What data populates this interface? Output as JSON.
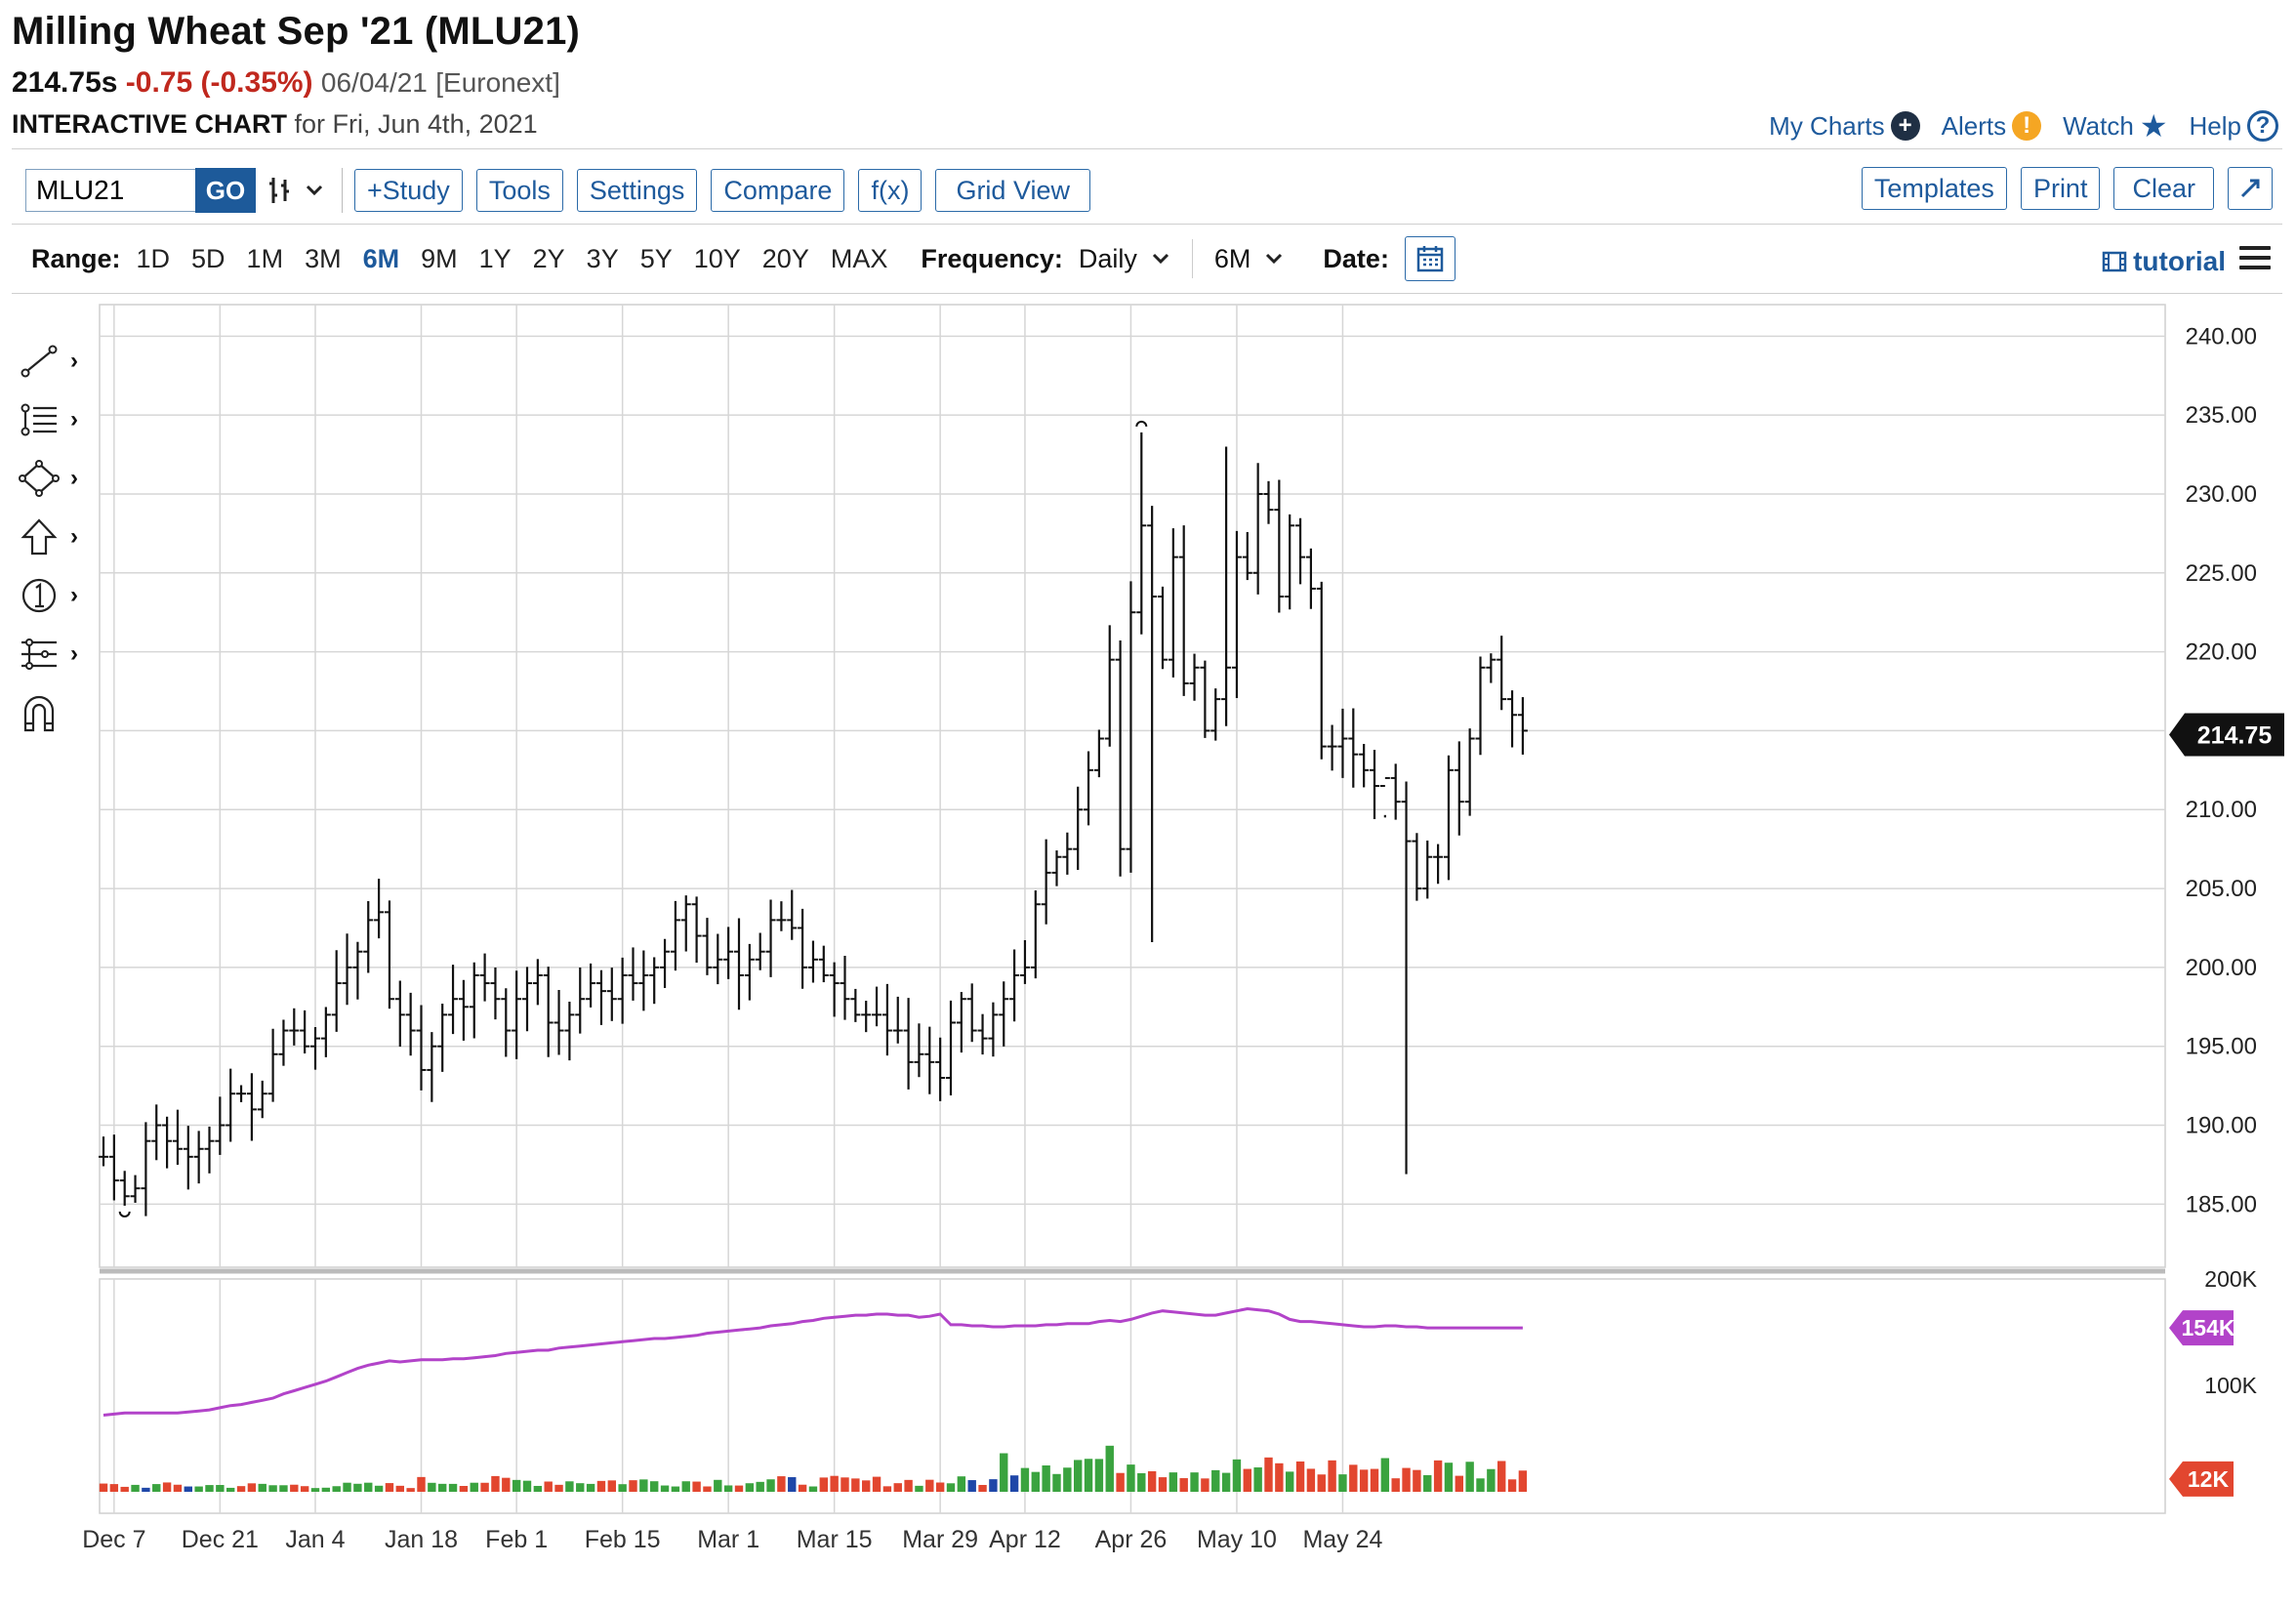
{
  "header": {
    "title": "Milling Wheat Sep '21 (MLU21)",
    "last": "214.75s",
    "change": "-0.75 (-0.35%)",
    "date": "06/04/21",
    "exchange": "[Euronext]",
    "chart_label": "INTERACTIVE CHART",
    "chart_for": "for Fri, Jun 4th, 2021"
  },
  "top_links": {
    "my_charts": "My Charts",
    "alerts": "Alerts",
    "watch": "Watch",
    "help": "Help"
  },
  "toolbar": {
    "symbol_value": "MLU21",
    "go": "GO",
    "study": "+Study",
    "tools": "Tools",
    "settings": "Settings",
    "compare": "Compare",
    "fx": "f(x)",
    "grid_view": "Grid View",
    "templates": "Templates",
    "print": "Print",
    "clear": "Clear"
  },
  "range_bar": {
    "range_label": "Range:",
    "ranges": [
      "1D",
      "5D",
      "1M",
      "3M",
      "6M",
      "9M",
      "1Y",
      "2Y",
      "3Y",
      "5Y",
      "10Y",
      "20Y",
      "MAX"
    ],
    "active_range": "6M",
    "frequency_label": "Frequency:",
    "frequency_value": "Daily",
    "period_value": "6M",
    "date_label": "Date:",
    "tutorial": "tutorial"
  },
  "colors": {
    "link": "#1e5a9c",
    "negative": "#c0281e",
    "up_volume": "#3aa33f",
    "down_volume": "#e2462f",
    "flat_volume": "#1f47a8",
    "open_interest": "#b243c9",
    "grid": "#d6d6d6"
  },
  "chart_data": {
    "type": "ohlc",
    "price_axis": {
      "ylim": [
        181,
        242
      ],
      "ticks": [
        "240.00",
        "235.00",
        "230.00",
        "225.00",
        "220.00",
        "215.00",
        "210.00",
        "205.00",
        "200.00",
        "195.00",
        "190.00",
        "185.00"
      ]
    },
    "last_price_label": "214.75",
    "x_labels": [
      "Dec 7",
      "Dec 21",
      "Jan 4",
      "Jan 18",
      "Feb 1",
      "Feb 15",
      "Mar 1",
      "Mar 15",
      "Mar 29",
      "Apr 12",
      "Apr 26",
      "May 10",
      "May 24"
    ],
    "closes": [
      188,
      186.5,
      185.5,
      186,
      189,
      190,
      189,
      188.5,
      188,
      188.5,
      189,
      190,
      192,
      192,
      191,
      192,
      194.5,
      196,
      196,
      195,
      195.5,
      197,
      199,
      200,
      201,
      203,
      203.5,
      198,
      197,
      196,
      193.5,
      195,
      197,
      198,
      197.5,
      199.5,
      199,
      198,
      196,
      198,
      199,
      199.5,
      196.5,
      196,
      197,
      198,
      199,
      198.5,
      198,
      199.5,
      199,
      199.5,
      200,
      201,
      203,
      204,
      202,
      200,
      200.5,
      201,
      199.5,
      200.5,
      201,
      203,
      203,
      202.5,
      200,
      200.5,
      199.5,
      199,
      198,
      197,
      197,
      197,
      196,
      196,
      194,
      194.5,
      194,
      193,
      196.5,
      198,
      196,
      195.5,
      197,
      198,
      199.5,
      200,
      204,
      206,
      207,
      207.5,
      210,
      212.5,
      214.5,
      219.5,
      207.5,
      222.5,
      228,
      223.5,
      219.5,
      226,
      218,
      219,
      215,
      217,
      219,
      226,
      225,
      230,
      229,
      223.5,
      228,
      226,
      224,
      214,
      214,
      214.5,
      213.5,
      212.5,
      211.5,
      212,
      210.5,
      208,
      205,
      207,
      207,
      212.5,
      210.5,
      214.5,
      219,
      219.5,
      217,
      216,
      215
    ],
    "price_extremes": {
      "high": "233.9",
      "low": "184.9"
    },
    "volume_axis": {
      "ticks": [
        "200K",
        "100K"
      ]
    },
    "open_interest_label": "154K",
    "volume_label": "12K"
  }
}
